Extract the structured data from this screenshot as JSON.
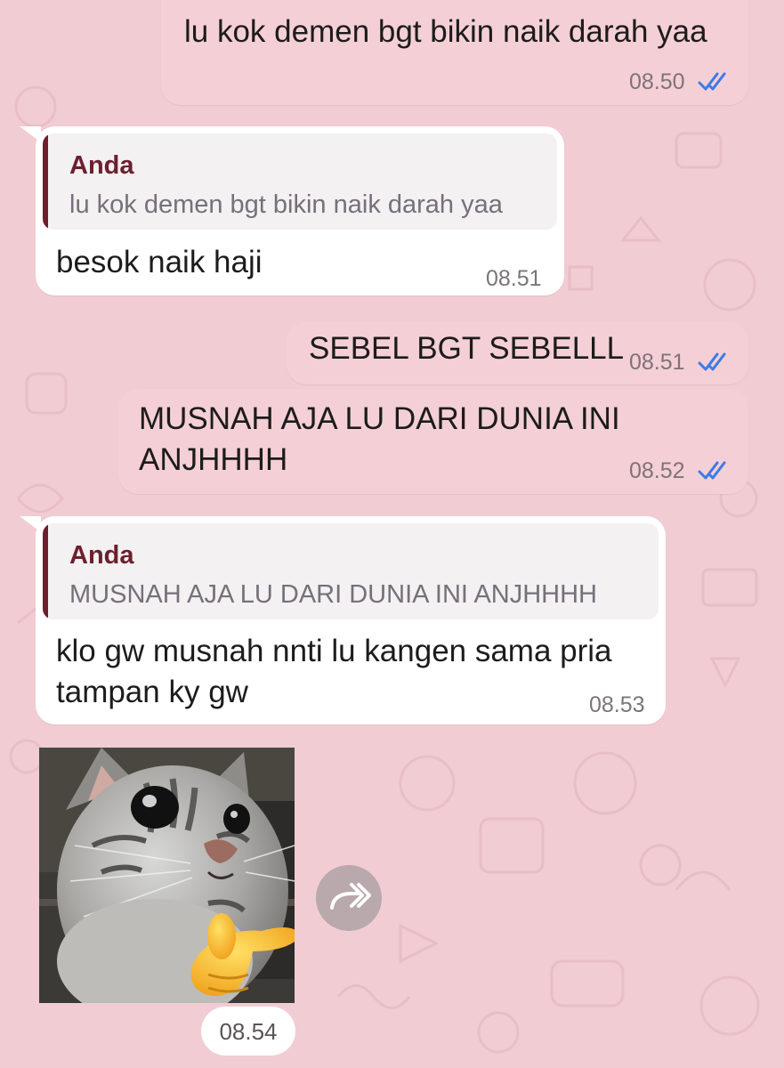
{
  "colors": {
    "wallpaper": "#f1ccd3",
    "outgoing_bubble": "#f5cfd6",
    "incoming_bubble": "#ffffff",
    "quote_accent": "#6d1f2e",
    "read_ticks": "#3b7be8"
  },
  "messages": [
    {
      "direction": "outgoing",
      "lines": [
        "lu kok demen bgt bikin naik darah yaa"
      ],
      "time": "08.50",
      "status": "read"
    },
    {
      "direction": "incoming",
      "reply_to": {
        "author": "Anda",
        "text": "lu kok demen bgt bikin naik darah yaa"
      },
      "lines": [
        "besok naik haji"
      ],
      "time": "08.51"
    },
    {
      "direction": "outgoing",
      "lines": [
        "SEBEL BGT SEBELLL"
      ],
      "time": "08.51",
      "status": "read"
    },
    {
      "direction": "outgoing",
      "lines": [
        "MUSNAH AJA LU DARI DUNIA INI",
        "ANJHHHH"
      ],
      "time": "08.52",
      "status": "read"
    },
    {
      "direction": "incoming",
      "reply_to": {
        "author": "Anda",
        "text": "MUSNAH AJA LU DARI DUNIA INI ANJHHHH"
      },
      "lines": [
        "klo gw musnah nnti lu kangen sama pria",
        "tampan ky gw"
      ],
      "time": "08.53"
    },
    {
      "direction": "incoming",
      "type": "sticker",
      "sticker": "cat-pointing-sticker",
      "time": "08.54",
      "forward_icon": "forward-icon"
    }
  ]
}
